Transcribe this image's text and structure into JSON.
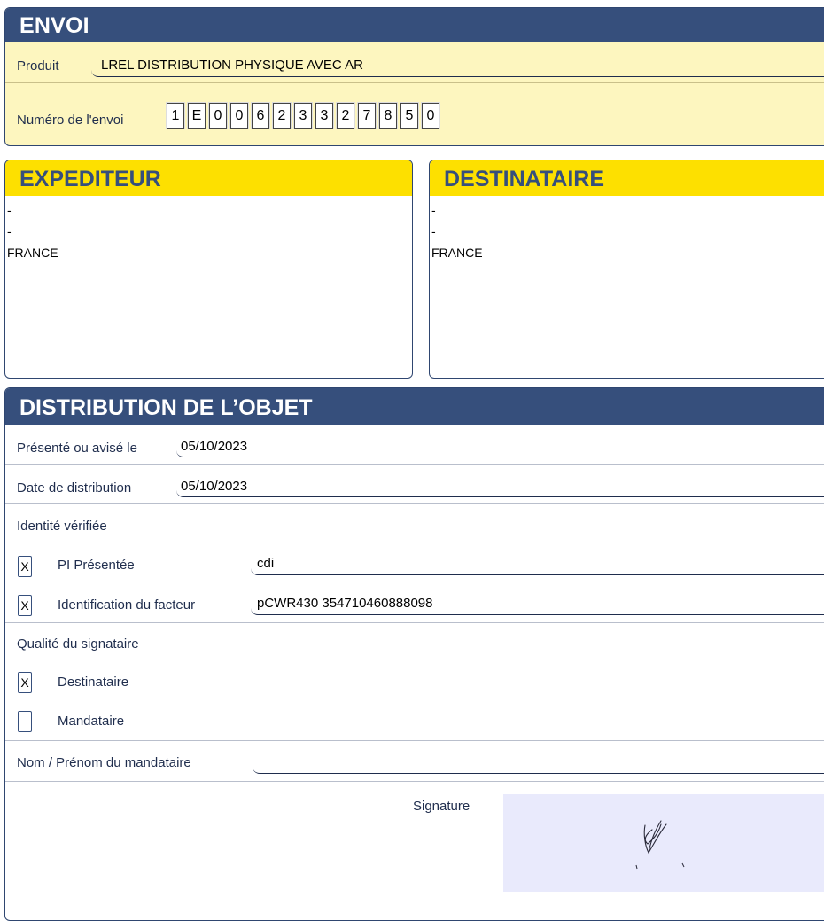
{
  "envoi": {
    "title": "ENVOI",
    "produit_label": "Produit",
    "produit_value": "LREL DISTRIBUTION PHYSIQUE AVEC AR",
    "numero_label": "Numéro de l'envoi",
    "numero_digits": [
      "1",
      "E",
      "0",
      "0",
      "6",
      "2",
      "3",
      "3",
      "2",
      "7",
      "8",
      "5",
      "0"
    ]
  },
  "expediteur": {
    "title": "EXPEDITEUR",
    "lines": [
      "-",
      "-",
      "FRANCE"
    ]
  },
  "destinataire": {
    "title": "DESTINATAIRE",
    "lines": [
      "-",
      "-",
      "FRANCE"
    ]
  },
  "distribution": {
    "title": "DISTRIBUTION DE L’OBJET",
    "presente_label": "Présenté ou avisé le",
    "presente_value": "05/10/2023",
    "date_label": "Date de distribution",
    "date_value": "05/10/2023",
    "identite_label": "Identité vérifiée",
    "pi_check": "X",
    "pi_label": "PI Présentée",
    "pi_value": "cdi",
    "facteur_check": "X",
    "facteur_label": "Identification du facteur",
    "facteur_value": "pCWR430 354710460888098",
    "qualite_label": "Qualité du signataire",
    "destinataire_check": "X",
    "destinataire_label": "Destinataire",
    "mandataire_check": "",
    "mandataire_label": "Mandataire",
    "nom_label": "Nom / Prénom du mandataire",
    "nom_value": "",
    "signature_label": "Signature"
  },
  "colors": {
    "navy": "#364f7c",
    "yellow": "#fde000",
    "pale_yellow": "#fdf6bf",
    "signature_bg": "#e9eafc"
  }
}
